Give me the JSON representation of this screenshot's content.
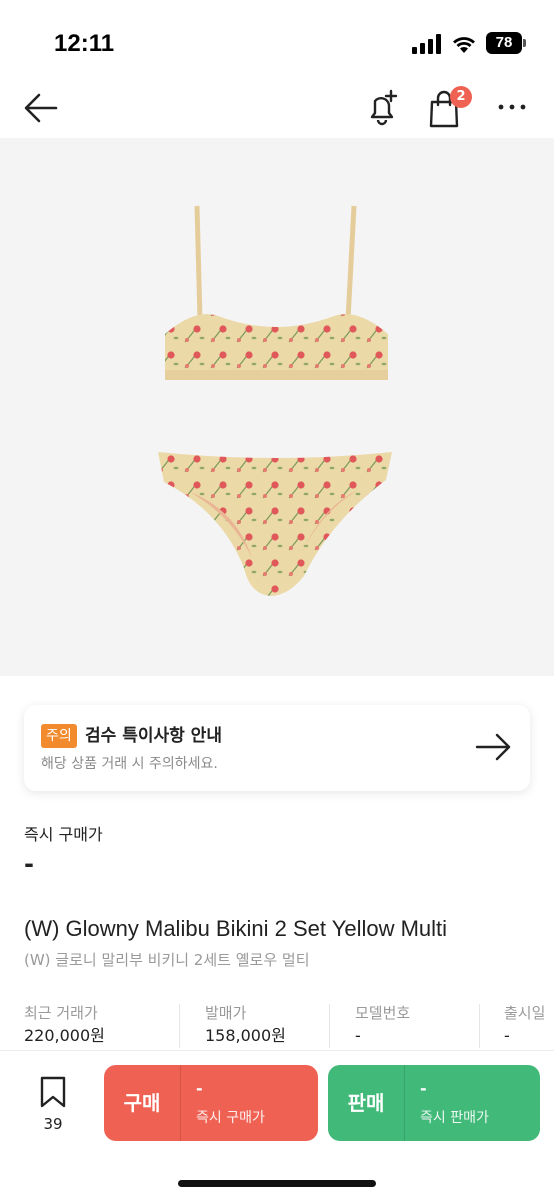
{
  "status_bar": {
    "time": "12:11",
    "battery": "78"
  },
  "nav": {
    "cart_badge": "2"
  },
  "notice": {
    "badge": "주의",
    "title": "검수 특이사항 안내",
    "subtitle": "해당 상품 거래 시 주의하세요."
  },
  "instant_price": {
    "label": "즉시 구매가",
    "value": "-"
  },
  "product": {
    "name": "(W) Glowny Malibu Bikini 2 Set Yellow Multi",
    "name_ko": "(W) 글로니 말리부 비키니 2세트 옐로우 멀티"
  },
  "info": [
    {
      "label": "최근 거래가",
      "value": "220,000원"
    },
    {
      "label": "발매가",
      "value": "158,000원"
    },
    {
      "label": "모델번호",
      "value": "-"
    },
    {
      "label": "출시일",
      "value": "-"
    }
  ],
  "bottom": {
    "wish_count": "39",
    "buy": {
      "label": "구매",
      "value": "-",
      "sub": "즉시 구매가"
    },
    "sell": {
      "label": "판매",
      "value": "-",
      "sub": "즉시 판매가"
    }
  },
  "colors": {
    "buy": "#ef6253",
    "sell": "#41b979",
    "notice_badge": "#f28a2e"
  }
}
